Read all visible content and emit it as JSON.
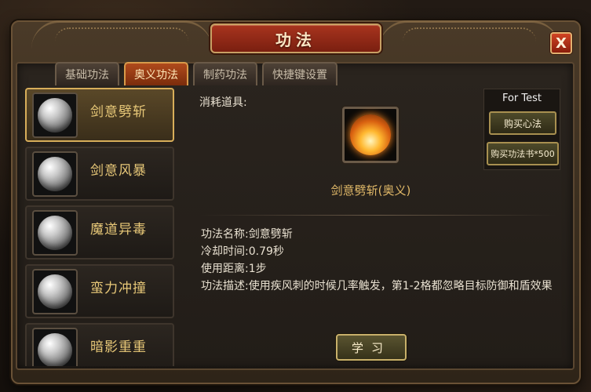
{
  "window": {
    "title": "功法",
    "close_label": "X"
  },
  "tabs": [
    {
      "label": "基础功法",
      "active": false
    },
    {
      "label": "奥义功法",
      "active": true
    },
    {
      "label": "制药功法",
      "active": false
    },
    {
      "label": "快捷键设置",
      "active": false
    }
  ],
  "skills": [
    {
      "name": "剑意劈斩",
      "icon": "blade-orb-icon",
      "selected": true
    },
    {
      "name": "剑意风暴",
      "icon": "storm-orb-icon",
      "selected": false
    },
    {
      "name": "魔道异毒",
      "icon": "poison-orb-icon",
      "selected": false
    },
    {
      "name": "蛮力冲撞",
      "icon": "charge-orb-icon",
      "selected": false
    },
    {
      "name": "暗影重重",
      "icon": "shadow-orb-icon",
      "selected": false
    }
  ],
  "detail": {
    "consume_label": "消耗道具:",
    "skill_title": "剑意劈斩(奥义)",
    "rows": [
      {
        "key": "功法名称:",
        "value": "剑意劈斩"
      },
      {
        "key": "冷却时间:",
        "value": "0.79秒"
      },
      {
        "key": "使用距离:",
        "value": "1步"
      },
      {
        "key": "功法描述:",
        "value": "使用疾风刺的时候几率触发，第1-2格都忽略目标防御和盾效果"
      }
    ],
    "learn_label": "学习"
  },
  "shop": {
    "header": "For Test",
    "buy_method_label": "购买心法",
    "buy_book_label": "购买功法书*500"
  },
  "colors": {
    "accent_gold": "#e8c878",
    "title_red": "#a8341e",
    "active_tab": "#b04a1c"
  }
}
